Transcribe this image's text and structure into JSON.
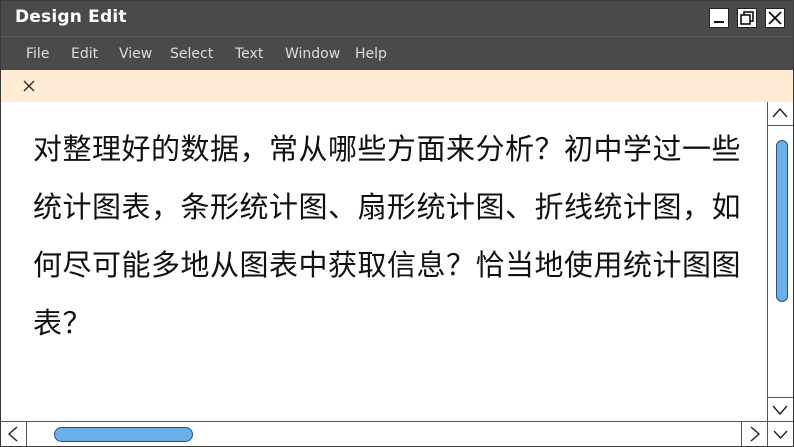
{
  "window": {
    "title": "Design Edit"
  },
  "title_buttons": [
    {
      "name": "minimize-button",
      "icon": "minimize-icon"
    },
    {
      "name": "maximize-button",
      "icon": "restore-icon"
    },
    {
      "name": "close-button",
      "icon": "close-icon"
    }
  ],
  "menu": {
    "items": [
      "File",
      "Edit",
      "View",
      "Select",
      "Text",
      "Window",
      "Help"
    ]
  },
  "notice": {
    "close_icon": "close-icon",
    "background": "#fdebd3"
  },
  "content": {
    "text": "对整理好的数据，常从哪些方面来分析？初中学过一些统计图表，条形统计图、扇形统计图、折线统计图，如何尽可能多地从图表中获取信息？恰当地使用统计图图表？"
  },
  "scrollbars": {
    "thumb_color": "#6aaeea",
    "vertical_position": 0.0,
    "horizontal_position": 0.0
  },
  "colors": {
    "titlebar": "#4a4a4a",
    "menu_text": "#dedede",
    "accent": "#6aaeea"
  }
}
